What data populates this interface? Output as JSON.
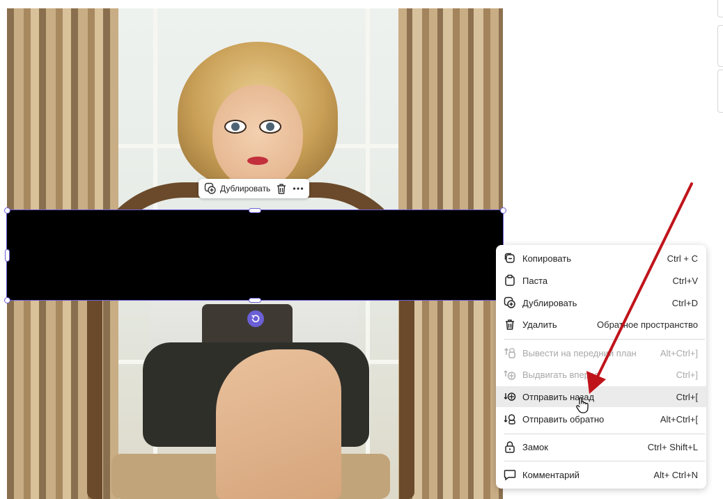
{
  "mini_toolbar": {
    "duplicate_label": "Дублировать",
    "delete_icon": "trash-icon",
    "more_icon": "more-dots-icon"
  },
  "context_menu": {
    "items": [
      {
        "label": "Копировать",
        "shortcut": "Ctrl + C",
        "icon": "copy-icon",
        "disabled": false
      },
      {
        "label": "Паста",
        "shortcut": "Ctrl+V",
        "icon": "paste-icon",
        "disabled": false
      },
      {
        "label": "Дублировать",
        "shortcut": "Ctrl+D",
        "icon": "duplicate-icon",
        "disabled": false
      },
      {
        "label": "Удалить",
        "shortcut": "Обратное пространство",
        "icon": "trash-icon",
        "disabled": false
      },
      {
        "label": "Вывести на передний план",
        "shortcut": "Alt+Ctrl+]",
        "icon": "bring-to-front-icon",
        "disabled": true
      },
      {
        "label": "Выдвигать вперед",
        "shortcut": "Ctrl+]",
        "icon": "bring-forward-icon",
        "disabled": true
      },
      {
        "label": "Отправить назад",
        "shortcut": "Ctrl+[",
        "icon": "send-backward-icon",
        "disabled": false,
        "hovered": true
      },
      {
        "label": "Отправить обратно",
        "shortcut": "Alt+Ctrl+[",
        "icon": "send-to-back-icon",
        "disabled": false
      },
      {
        "label": "Замок",
        "shortcut": "Ctrl+ Shift+L",
        "icon": "lock-icon",
        "disabled": false
      },
      {
        "label": "Комментарий",
        "shortcut": "Alt+ Ctrl+N",
        "icon": "comment-icon",
        "disabled": false
      }
    ]
  },
  "colors": {
    "selection": "#6b5fd6",
    "annotation_arrow": "#c0141b",
    "shape_fill": "#000000"
  }
}
